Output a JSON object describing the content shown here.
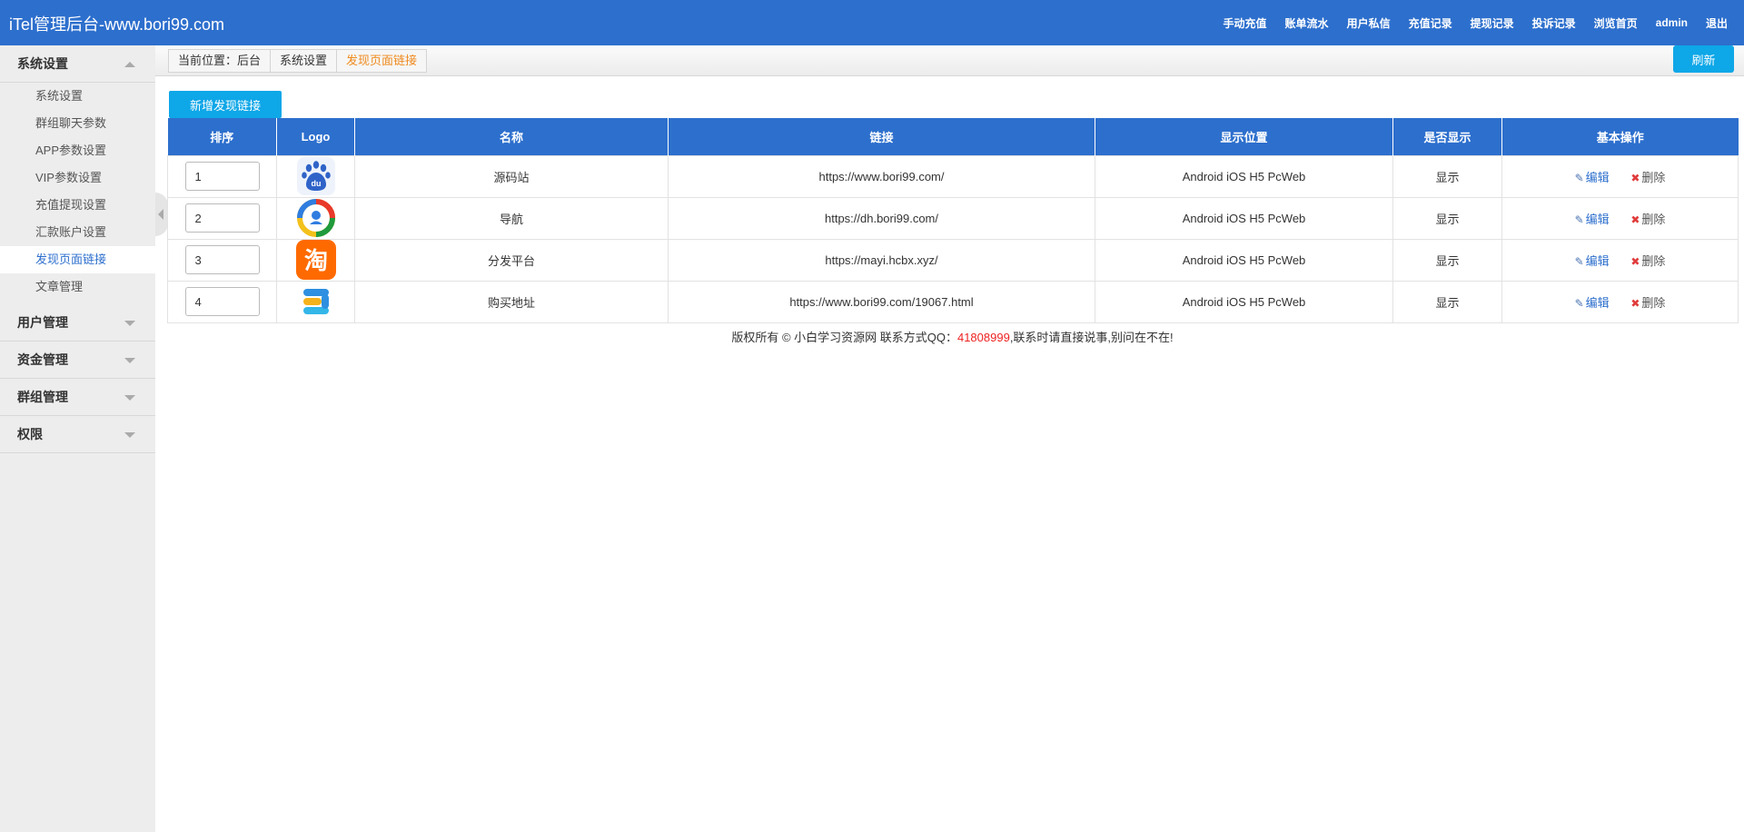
{
  "header": {
    "title": "iTel管理后台-www.bori99.com",
    "nav": [
      "手动充值",
      "账单流水",
      "用户私信",
      "充值记录",
      "提现记录",
      "投诉记录",
      "浏览首页",
      "admin",
      "退出"
    ]
  },
  "sidebar": {
    "groups": [
      {
        "label": "系统设置",
        "expanded": true,
        "items": [
          {
            "label": "系统设置",
            "active": false
          },
          {
            "label": "群组聊天参数",
            "active": false
          },
          {
            "label": "APP参数设置",
            "active": false
          },
          {
            "label": "VIP参数设置",
            "active": false
          },
          {
            "label": "充值提现设置",
            "active": false
          },
          {
            "label": "汇款账户设置",
            "active": false
          },
          {
            "label": "发现页面链接",
            "active": true
          },
          {
            "label": "文章管理",
            "active": false
          }
        ]
      },
      {
        "label": "用户管理",
        "expanded": false
      },
      {
        "label": "资金管理",
        "expanded": false
      },
      {
        "label": "群组管理",
        "expanded": false
      },
      {
        "label": "权限",
        "expanded": false
      }
    ]
  },
  "breadcrumb": [
    "当前位置：后台",
    "系统设置",
    "发现页面链接"
  ],
  "toolbar": {
    "refresh_label": "刷新",
    "add_label": "新增发现链接"
  },
  "table": {
    "columns": [
      "排序",
      "Logo",
      "名称",
      "链接",
      "显示位置",
      "是否显示",
      "基本操作"
    ],
    "rows": [
      {
        "sort": "1",
        "logo": "baidu-logo",
        "name": "源码站",
        "link": "https://www.bori99.com/",
        "position": "Android iOS H5 PcWeb",
        "shown": "显示"
      },
      {
        "sort": "2",
        "logo": "nav-circle-logo",
        "name": "导航",
        "link": "https://dh.bori99.com/",
        "position": "Android iOS H5 PcWeb",
        "shown": "显示"
      },
      {
        "sort": "3",
        "logo": "taobao-logo",
        "name": "分发平台",
        "link": "https://mayi.hcbx.xyz/",
        "position": "Android iOS H5 PcWeb",
        "shown": "显示"
      },
      {
        "sort": "4",
        "logo": "shop-logo",
        "name": "购买地址",
        "link": "https://www.bori99.com/19067.html",
        "position": "Android iOS H5 PcWeb",
        "shown": "显示"
      }
    ],
    "actions": {
      "edit": "编辑",
      "delete": "删除"
    }
  },
  "footer": {
    "prefix": "版权所有 © 小白学习资源网 联系方式QQ：",
    "qq": "41808999",
    "suffix": ",联系时请直接说事,别问在不在!"
  },
  "colors": {
    "header": "#2d6fcd",
    "button": "#0ea7e8",
    "active": "#2d6fcd",
    "breadcrumb_current": "#ef8a1e",
    "qq": "#e22222"
  }
}
